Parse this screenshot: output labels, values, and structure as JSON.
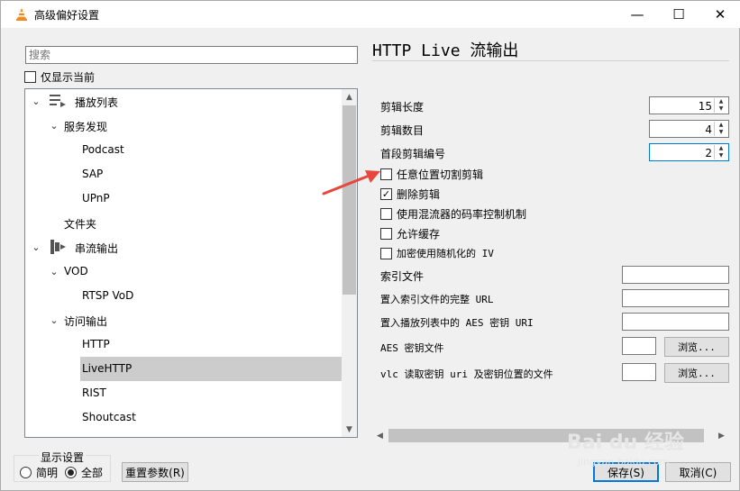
{
  "window": {
    "title": "高级偏好设置",
    "minimize": "—",
    "maximize": "☐",
    "close": "✕"
  },
  "left": {
    "search_placeholder": "搜索",
    "only_current_label": "仅显示当前",
    "tree": [
      {
        "label": "播放列表",
        "arrow": "⌄",
        "icon": "playlist-icon"
      },
      {
        "label": "服务发现",
        "arrow": "⌄"
      },
      {
        "label": "Podcast"
      },
      {
        "label": "SAP"
      },
      {
        "label": "UPnP"
      },
      {
        "label": "文件夹"
      },
      {
        "label": "串流输出",
        "arrow": "⌄",
        "icon": "stream-output-icon"
      },
      {
        "label": "VOD",
        "arrow": "⌄"
      },
      {
        "label": "RTSP VoD"
      },
      {
        "label": "访问输出",
        "arrow": "⌄"
      },
      {
        "label": "HTTP"
      },
      {
        "label": "LiveHTTP",
        "selected": true
      },
      {
        "label": "RIST"
      },
      {
        "label": "Shoutcast"
      }
    ],
    "display_group_title": "显示设置",
    "radio_simple": "简明",
    "radio_all": "全部",
    "reset_button": "重置参数(R)"
  },
  "right": {
    "title": "HTTP Live 流输出",
    "segment_length_label": "剪辑长度",
    "segment_length_value": "15",
    "segment_count_label": "剪辑数目",
    "segment_count_value": "4",
    "first_segment_label": "首段剪辑编号",
    "first_segment_value": "2",
    "split_anywhere_label": "任意位置切割剪辑",
    "delete_segments_label": "删除剪辑",
    "use_muxer_label": "使用混流器的码率控制机制",
    "allow_cache_label": "允许缓存",
    "random_iv_label": "加密使用随机化的 IV",
    "index_file_label": "索引文件",
    "full_url_label": "置入索引文件的完整 URL",
    "aes_uri_label": "置入播放列表中的 AES 密钥 URI",
    "aes_key_file_label": "AES 密钥文件",
    "vlc_key_label": "vlc 读取密钥 uri 及密钥位置的文件",
    "browse_label": "浏览...",
    "save_button": "保存(S)",
    "cancel_button": "取消(C)"
  },
  "watermark": {
    "main": "Bai du 经验",
    "sub": "jingyan.baidu.com"
  },
  "colors": {
    "accent": "#0078d7",
    "arrow": "#e8473f",
    "selected": "#cccccc"
  }
}
